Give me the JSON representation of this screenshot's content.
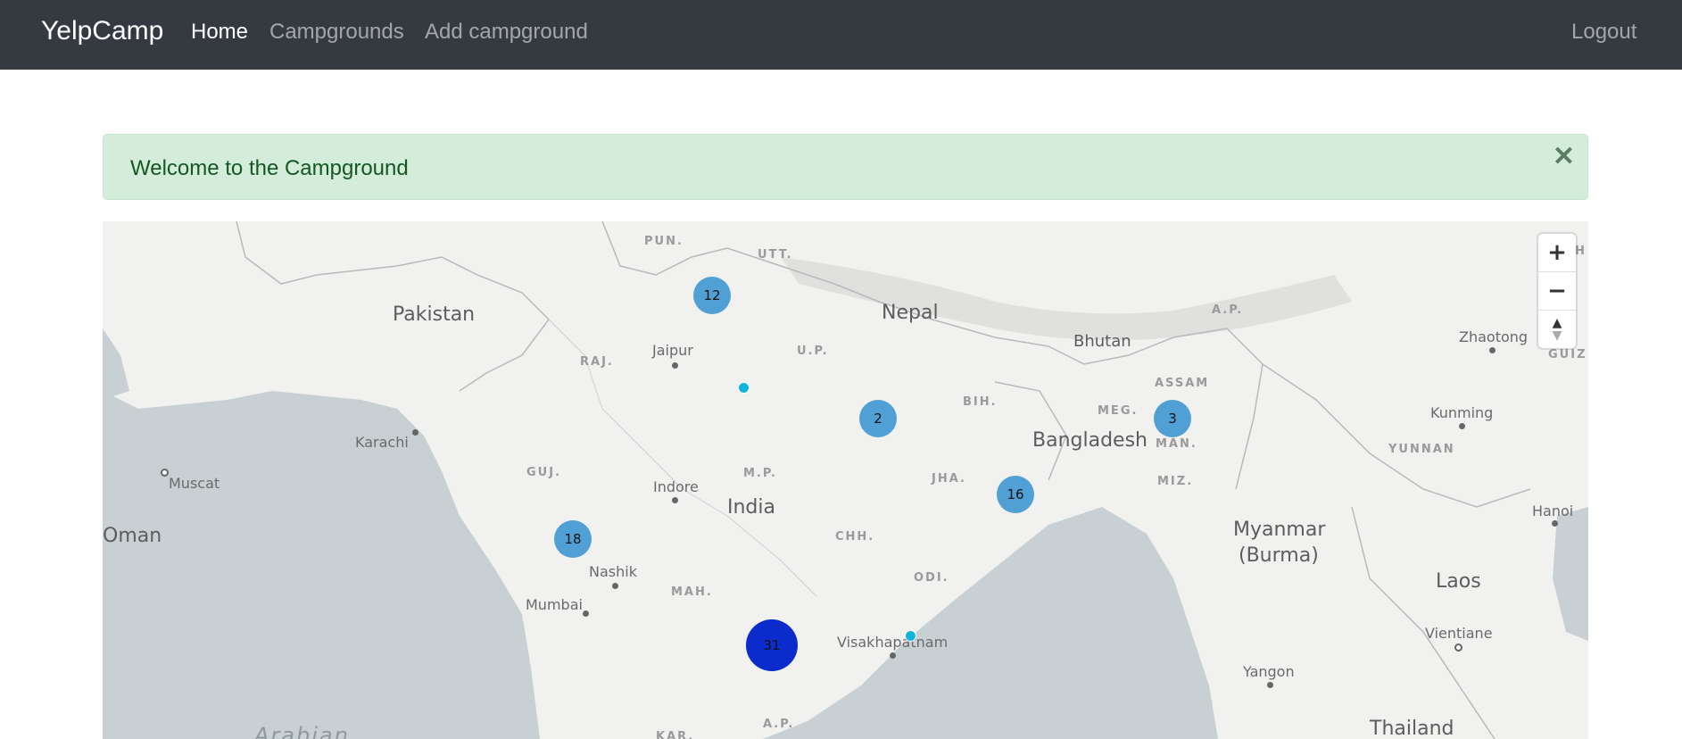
{
  "navbar": {
    "brand": "YelpCamp",
    "links": [
      "Home",
      "Campgrounds",
      "Add campground"
    ],
    "logout": "Logout"
  },
  "alert": {
    "message": "Welcome to the Campground",
    "close": "✕"
  },
  "map": {
    "countries": [
      "Pakistan",
      "Nepal",
      "Bhutan",
      "Bangladesh",
      "India",
      "Oman",
      "Myanmar",
      "(Burma)",
      "Laos",
      "Thailand"
    ],
    "states": [
      "PUN.",
      "UTT.",
      "RAJ.",
      "U.P.",
      "BIH.",
      "A.P.",
      "ASSAM",
      "MEG.",
      "MAN.",
      "MIZ.",
      "GUJ.",
      "M.P.",
      "JHA.",
      "CHH.",
      "ODI.",
      "MAH.",
      "A.P.",
      "YUNNAN",
      "KAR.",
      "GUIZ",
      "H"
    ],
    "cities": [
      "Jaipur",
      "Karachi",
      "Muscat",
      "Indore",
      "Nashik",
      "Mumbai",
      "Visakhapatnam",
      "Zhaotong",
      "Kunming",
      "Hanoi",
      "Vientiane",
      "Yangon"
    ],
    "water": "Arabian",
    "clusters": [
      "12",
      "2",
      "3",
      "16",
      "18",
      "31"
    ],
    "controls": {
      "zoom_in": "+",
      "zoom_out": "−",
      "compass_up": "▲",
      "compass_down": "▼"
    },
    "colors": {
      "land": "#f1f1f0",
      "water": "#c8d0d3",
      "cluster_small": "#51a0d5",
      "cluster_large": "#0c2bcc",
      "point": "#11b4da"
    }
  }
}
